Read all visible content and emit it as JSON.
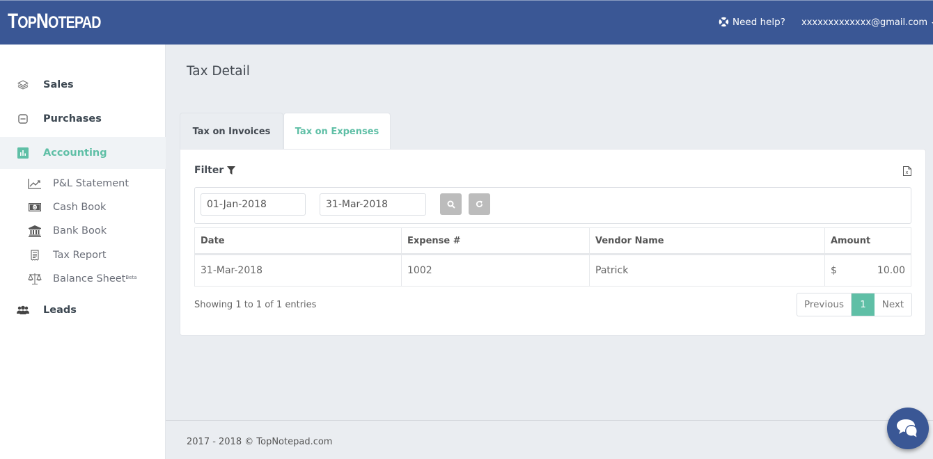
{
  "header": {
    "logo": "TopNotepad",
    "logo_parts": [
      "T",
      "OP",
      "N",
      "OTEPAD"
    ],
    "help_label": "Need help?",
    "user_email": "xxxxxxxxxxxxx@gmail.com"
  },
  "sidebar": {
    "items": [
      {
        "label": "Sales",
        "icon": "layers-icon"
      },
      {
        "label": "Purchases",
        "icon": "minus-square-icon"
      },
      {
        "label": "Accounting",
        "icon": "bar-chart-icon",
        "active": true
      },
      {
        "label": "Leads",
        "icon": "users-icon"
      }
    ],
    "sub_items": [
      {
        "label": "P&L Statement",
        "icon": "line-chart-icon"
      },
      {
        "label": "Cash Book",
        "icon": "money-icon"
      },
      {
        "label": "Bank Book",
        "icon": "bank-icon"
      },
      {
        "label": "Tax Report",
        "icon": "receipt-icon"
      },
      {
        "label": "Balance Sheet",
        "badge": "Beta",
        "icon": "balance-scale-icon"
      }
    ]
  },
  "main": {
    "title": "Tax Detail",
    "tabs": [
      {
        "label": "Tax on Invoices",
        "active": false
      },
      {
        "label": "Tax on Expenses",
        "active": true
      }
    ],
    "filter": {
      "label": "Filter",
      "from_date": "01-Jan-2018",
      "to_date": "31-Mar-2018"
    },
    "table": {
      "columns": [
        "Date",
        "Expense #",
        "Vendor Name",
        "Amount"
      ],
      "rows": [
        {
          "date": "31-Mar-2018",
          "expense_no": "1002",
          "vendor": "Patrick",
          "currency": "$",
          "amount": "10.00"
        }
      ]
    },
    "showing": "Showing 1 to 1 of 1 entries",
    "pagination": {
      "previous": "Previous",
      "current": "1",
      "next": "Next"
    }
  },
  "footer": {
    "text": "2017 - 2018 © TopNotepad.com"
  },
  "colors": {
    "brand": "#3a5795",
    "accent": "#5fbfa6"
  }
}
